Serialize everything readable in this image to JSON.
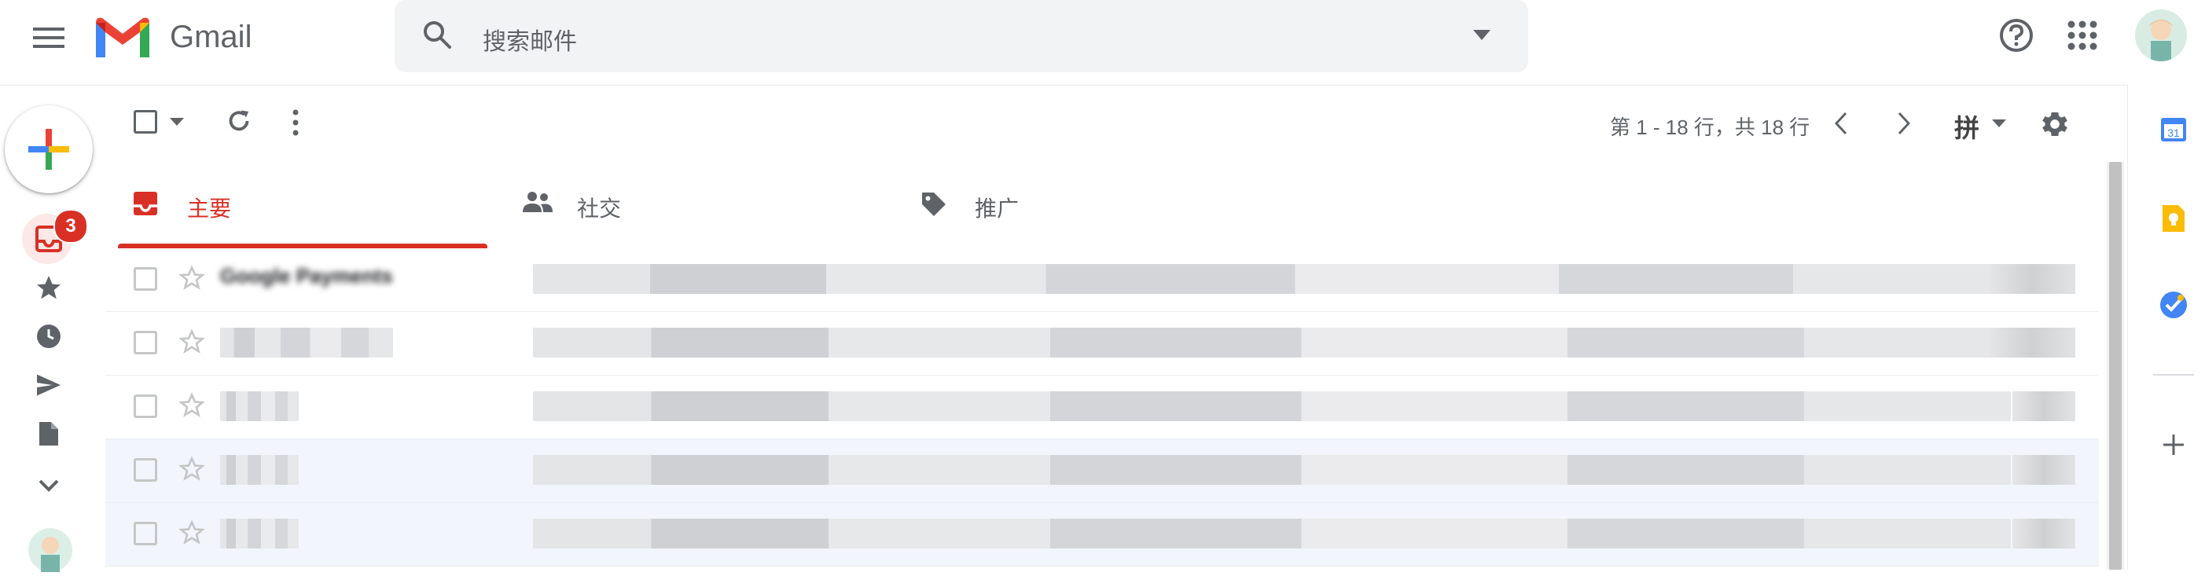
{
  "app": {
    "name": "Gmail"
  },
  "search": {
    "placeholder": "搜索邮件"
  },
  "nav": {
    "inbox_badge": "3"
  },
  "toolbar": {
    "pagination": "第 1 - 18 行，共 18 行",
    "input_tool": "拼"
  },
  "tabs": [
    {
      "label": "主要",
      "icon": "inbox-icon",
      "active": true
    },
    {
      "label": "社交",
      "icon": "people-icon",
      "active": false
    },
    {
      "label": "推广",
      "icon": "tag-icon",
      "active": false
    }
  ],
  "emails": [
    {
      "sender": "Google Payments",
      "read": false
    },
    {
      "sender": "",
      "read": false
    },
    {
      "sender": "",
      "read": false
    },
    {
      "sender": "",
      "read": true
    },
    {
      "sender": "",
      "read": true
    }
  ],
  "colors": {
    "accent": "#d93025",
    "badge": "#d93025",
    "read_row": "#f2f6fc"
  }
}
